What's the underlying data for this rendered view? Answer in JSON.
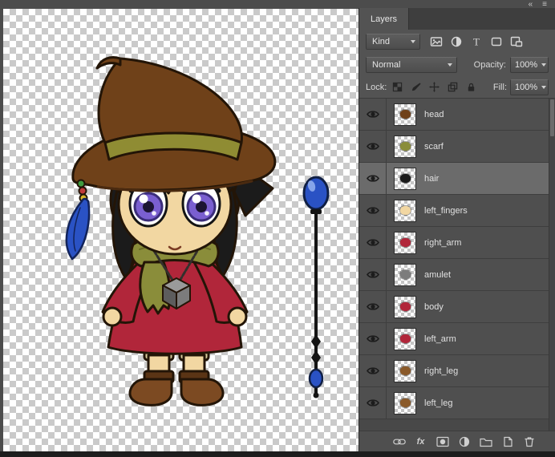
{
  "window": {
    "collapse_icon": "«",
    "menu_icon": "≡"
  },
  "palette": {
    "canvas_check_a": "#ffffff",
    "canvas_check_b": "#cacaca",
    "hat": "#6f4119",
    "band": "#8f8c33",
    "hair": "#1b1b1b",
    "skin": "#f2d7a2",
    "eye": "#7a5fd0",
    "eye_dark": "#3b2d7a",
    "scarf": "#8a8d3a",
    "dress": "#b1263a",
    "boot": "#7c4a22",
    "boot_dark": "#5a3415",
    "sock": "#d9cc9e",
    "orb": "#2a52c4",
    "amulet_light": "#9a9a9a",
    "amulet_mid": "#7c7c7c",
    "amulet_dark": "#5d5d5d",
    "bead_green": "#3f9b3f",
    "bead_red": "#c03a3a",
    "bead_yellow": "#d8b62c"
  },
  "panel": {
    "tab": "Layers",
    "kind_label": "Kind",
    "blend_mode": "Normal",
    "opacity_label": "Opacity:",
    "opacity_value": "100%",
    "lock_label": "Lock:",
    "fill_label": "Fill:",
    "fill_value": "100%",
    "fx_label": "fx",
    "filter_icons": [
      "pixel-layers-filter",
      "adjustment-layers-filter",
      "type-layers-filter",
      "shape-layers-filter",
      "smart-object-filter"
    ],
    "lock_icons": [
      "lock-transparent-pixels",
      "lock-image-pixels",
      "lock-position",
      "lock-artboard-nesting",
      "lock-all"
    ],
    "bottom_icons": [
      "link-layers",
      "layer-styles-fx",
      "add-layer-mask",
      "new-adjustment-layer",
      "new-group",
      "new-layer",
      "delete-layer"
    ],
    "layers": [
      {
        "name": "head",
        "visible": true,
        "selected": false,
        "thumb_color": "#6f4119"
      },
      {
        "name": "scarf",
        "visible": true,
        "selected": false,
        "thumb_color": "#8a8d3a"
      },
      {
        "name": "hair",
        "visible": true,
        "selected": true,
        "thumb_color": "#1b1b1b"
      },
      {
        "name": "left_fingers",
        "visible": true,
        "selected": false,
        "thumb_color": "#f2d7a2"
      },
      {
        "name": "right_arm",
        "visible": true,
        "selected": false,
        "thumb_color": "#b1263a"
      },
      {
        "name": "amulet",
        "visible": true,
        "selected": false,
        "thumb_color": "#7c7c7c"
      },
      {
        "name": "body",
        "visible": true,
        "selected": false,
        "thumb_color": "#b1263a"
      },
      {
        "name": "left_arm",
        "visible": true,
        "selected": false,
        "thumb_color": "#b1263a"
      },
      {
        "name": "right_leg",
        "visible": true,
        "selected": false,
        "thumb_color": "#8a5a2a"
      },
      {
        "name": "left_leg",
        "visible": true,
        "selected": false,
        "thumb_color": "#8a5a2a"
      }
    ]
  }
}
